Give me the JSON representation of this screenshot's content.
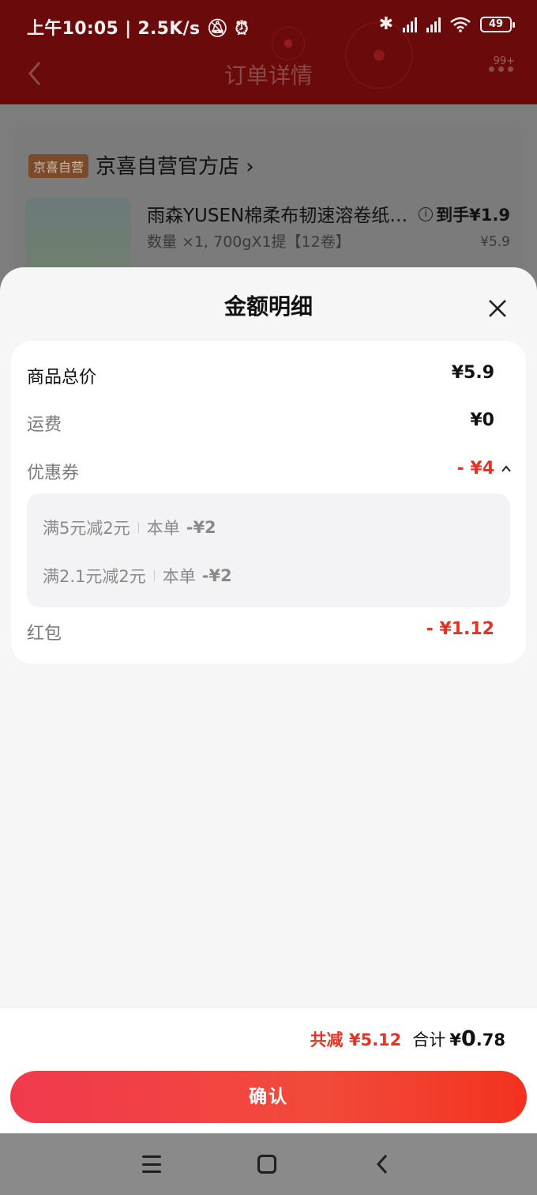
{
  "status_bar": {
    "time": "上午10:05",
    "net_speed": "2.5K/s",
    "battery": "49"
  },
  "nav": {
    "title": "订单详情",
    "badge": "99+"
  },
  "order": {
    "store_tag": "京喜自营",
    "store_name": "京喜自营官方店",
    "product_title": "雨森YUSEN棉柔布韧速溶卷纸…",
    "product_spec": "数量 ×1, 700gX1提【12卷】",
    "final_price": "到手¥1.9",
    "orig_price": "¥5.9"
  },
  "sheet": {
    "title": "金额明细",
    "rows": [
      {
        "label": "商品总价",
        "amount": "¥5.9"
      },
      {
        "label": "运费",
        "amount": "¥0"
      },
      {
        "label": "优惠券",
        "amount": "- ¥4"
      },
      {
        "label": "红包",
        "amount": "- ¥1.12"
      }
    ],
    "coupons": [
      {
        "name": "满5元减2元",
        "scope": "本单",
        "value": "-¥2"
      },
      {
        "name": "满2.1元减2元",
        "scope": "本单",
        "value": "-¥2"
      }
    ]
  },
  "summary": {
    "reduce": "共减 ¥5.12",
    "total_label": "合计",
    "total_symbol": "¥",
    "total_int": "0",
    "total_dec": ".78"
  },
  "confirm_label": "确认",
  "colors": {
    "accent_red": "#e73226",
    "button_start": "#f1394d",
    "button_end": "#f3321f",
    "header_bg": "#6b0a0a"
  }
}
